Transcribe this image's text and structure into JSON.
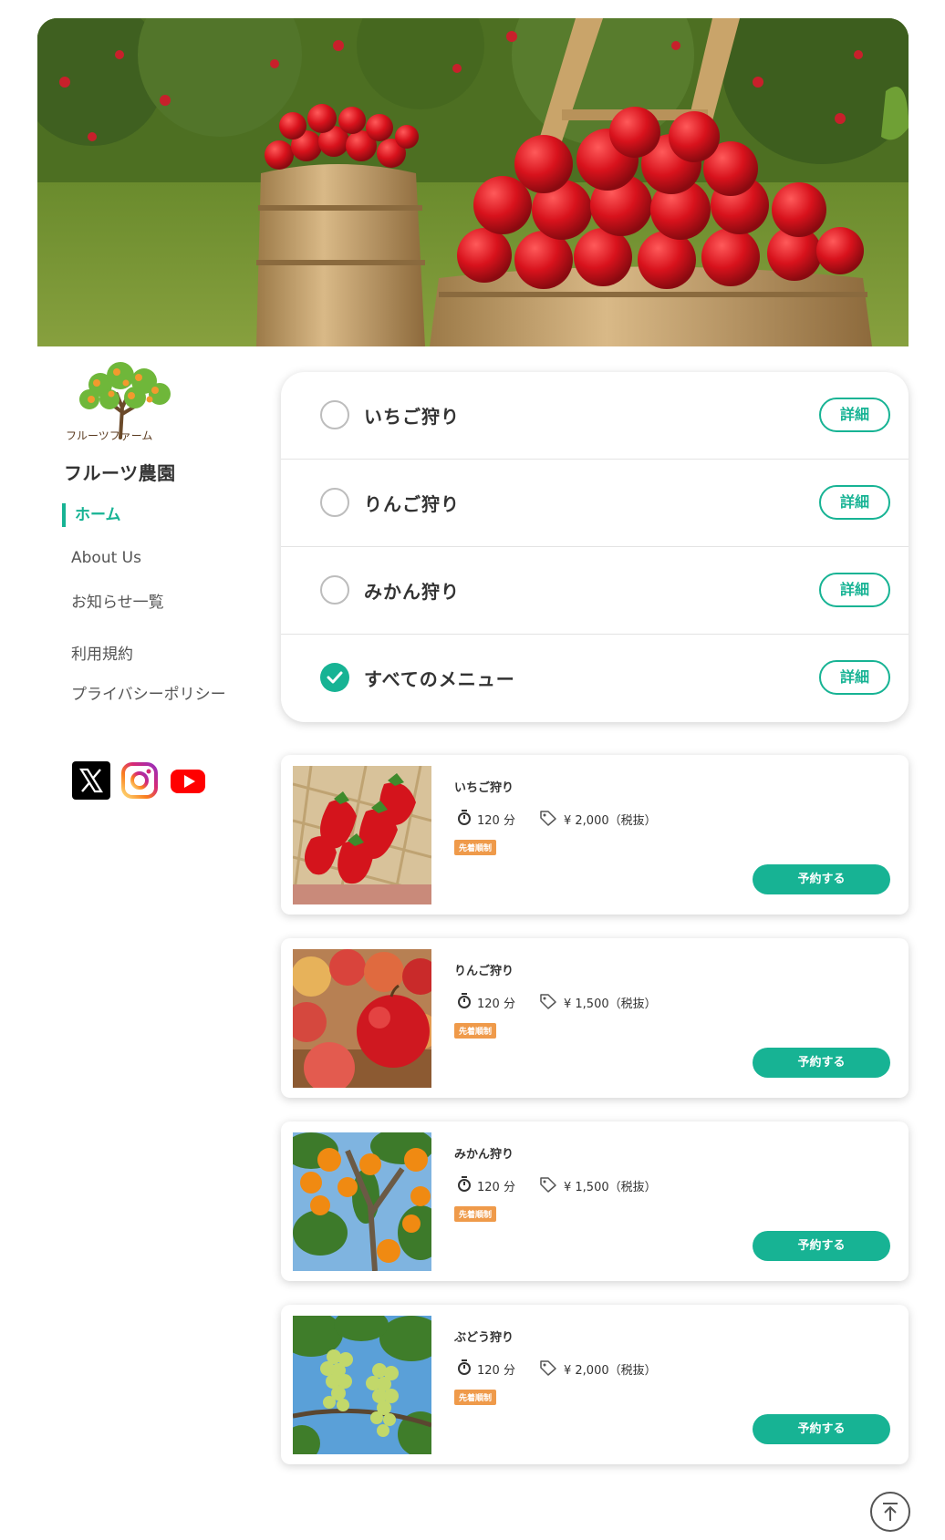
{
  "site": {
    "logo_text": "フルーツファーム",
    "title": "フルーツ農園"
  },
  "nav": {
    "home": "ホーム",
    "about": "About Us",
    "news": "お知らせ一覧",
    "terms": "利用規約",
    "privacy": "プライバシーポリシー"
  },
  "social": [
    "x-icon",
    "instagram-icon",
    "youtube-icon"
  ],
  "filter": {
    "detail_label": "詳細",
    "options": [
      {
        "label": "いちご狩り",
        "checked": false
      },
      {
        "label": "りんご狩り",
        "checked": false
      },
      {
        "label": "みかん狩り",
        "checked": false
      },
      {
        "label": "すべてのメニュー",
        "checked": true
      }
    ]
  },
  "tours": [
    {
      "title": "いちご狩り",
      "duration": "120 分",
      "price": "¥ 2,000（税抜）",
      "badge": "先着順制",
      "button": "予約する",
      "image": "strawberry"
    },
    {
      "title": "りんご狩り",
      "duration": "120 分",
      "price": "¥ 1,500（税抜）",
      "badge": "先着順制",
      "button": "予約する",
      "image": "apple"
    },
    {
      "title": "みかん狩り",
      "duration": "120 分",
      "price": "¥ 1,500（税抜）",
      "badge": "先着順制",
      "button": "予約する",
      "image": "mandarin"
    },
    {
      "title": "ぶどう狩り",
      "duration": "120 分",
      "price": "¥ 2,000（税抜）",
      "badge": "先着順制",
      "button": "予約する",
      "image": "grape"
    }
  ],
  "colors": {
    "accent": "#17b394",
    "badge": "#ef9a4a",
    "text": "#333333"
  }
}
